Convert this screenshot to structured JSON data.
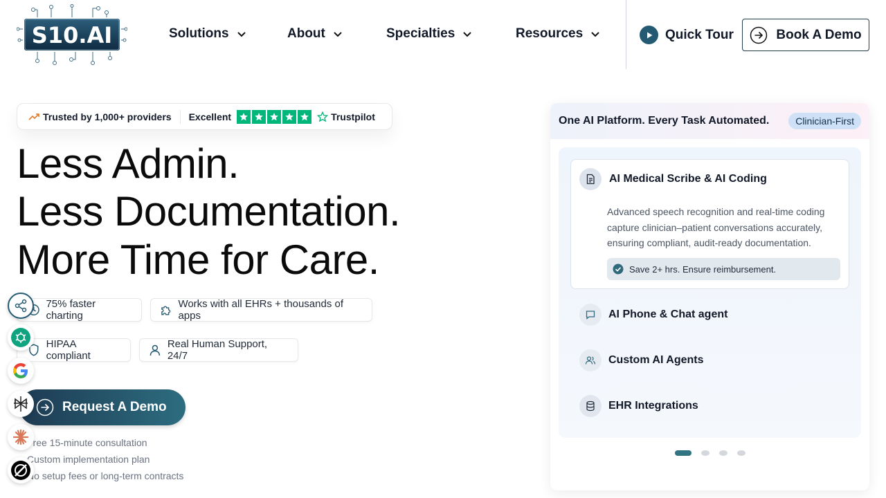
{
  "brand": {
    "logo_text": "S10.AI"
  },
  "nav": {
    "items": [
      {
        "label": "Solutions"
      },
      {
        "label": "About"
      },
      {
        "label": "Specialties"
      },
      {
        "label": "Resources"
      }
    ],
    "quick_tour": "Quick Tour",
    "book_demo": "Book A Demo"
  },
  "trust": {
    "providers": "Trusted by 1,000+ providers",
    "rating_word": "Excellent",
    "stars": 5,
    "platform": "Trustpilot"
  },
  "hero": {
    "lines": [
      "Less Admin.",
      "Less Documentation.",
      "More Time for Care."
    ]
  },
  "chips": [
    {
      "label": "75% faster charting",
      "icon": "clock-icon"
    },
    {
      "label": "Works with all EHRs + thousands of apps",
      "icon": "puzzle-icon"
    },
    {
      "label": "HIPAA compliant",
      "icon": "shield-icon"
    },
    {
      "label": "Real Human Support, 24/7",
      "icon": "user-icon"
    }
  ],
  "cta": {
    "label": "Request A Demo",
    "bullets": [
      "Free 15-minute consultation",
      "Custom implementation plan",
      "No setup fees or long-term contracts"
    ]
  },
  "floating": [
    "share-icon",
    "chatgpt-icon",
    "google-icon",
    "perplexity-icon",
    "claude-icon",
    "grok-icon"
  ],
  "card": {
    "title": "One AI Platform. Every Task Automated.",
    "badge": "Clinician-First",
    "active": {
      "title": "AI Medical Scribe & AI Coding",
      "description": "Advanced speech recognition and real-time coding capture clinician–patient conversations accurately, ensuring compliant, audit-ready documentation.",
      "save": "Save 2+ hrs. Ensure reimbursement."
    },
    "features": [
      {
        "title": "AI Phone & Chat agent",
        "icon": "chat-icon"
      },
      {
        "title": "Custom AI Agents",
        "icon": "users-icon"
      },
      {
        "title": "EHR Integrations",
        "icon": "database-icon"
      }
    ],
    "carousel": {
      "total": 4,
      "active": 1
    }
  },
  "colors": {
    "primary": "#245a72",
    "accent": "#2f7480",
    "trustpilot": "#00b67a"
  }
}
